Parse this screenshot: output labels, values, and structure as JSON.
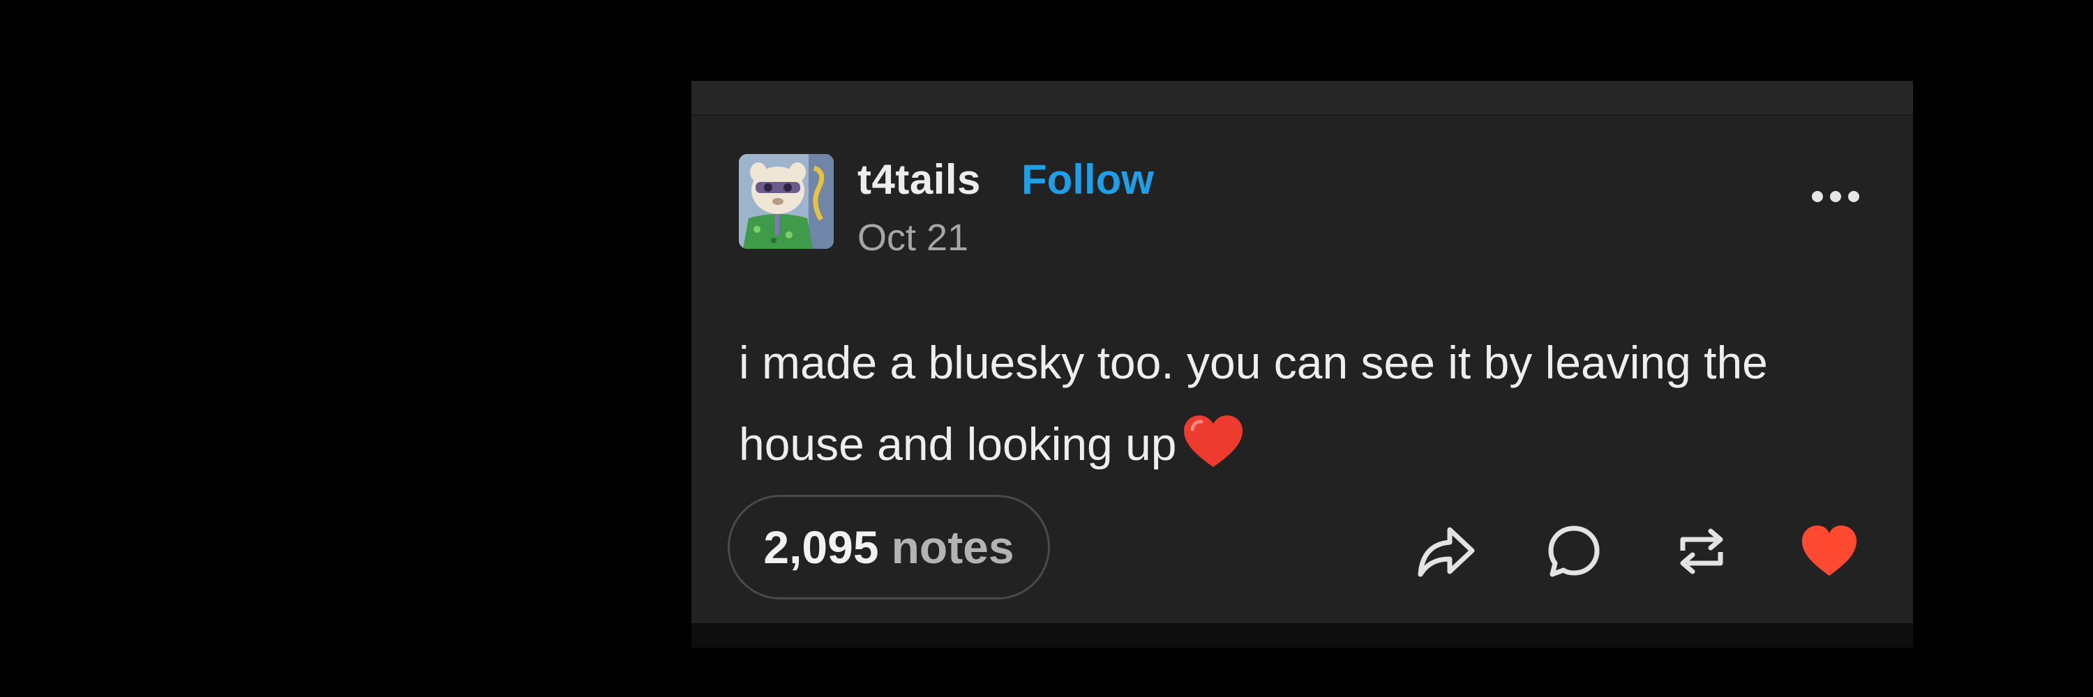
{
  "post": {
    "username": "t4tails",
    "follow_label": "Follow",
    "date": "Oct 21",
    "text": "i made a bluesky too. you can see it by leaving the house and looking up",
    "inline_emoji": "red-heart-emoji",
    "more_icon": "ellipsis-icon"
  },
  "footer": {
    "notes_count": "2,095",
    "notes_label": "notes",
    "actions": [
      "share-icon",
      "reply-icon",
      "reblog-icon",
      "like-icon"
    ],
    "liked": true
  },
  "colors": {
    "page_background": "#000000",
    "card_background": "#222222",
    "follow_link": "#1e9fe8",
    "like_active": "#ff4930",
    "text_primary": "#eeeeee",
    "text_secondary": "#a6a6a6"
  }
}
